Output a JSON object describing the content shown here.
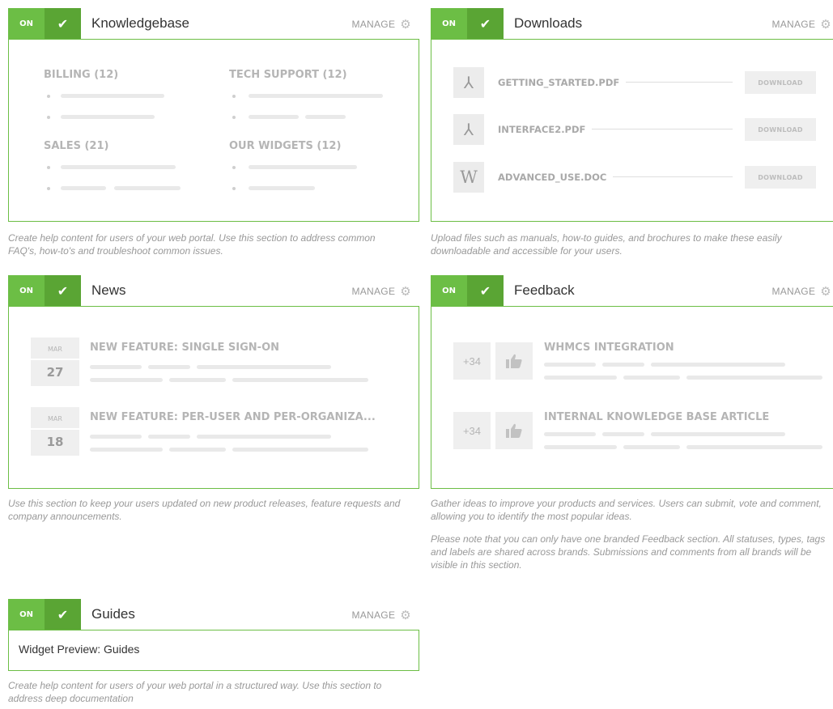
{
  "toggle": {
    "on_label": "ON",
    "check_icon": "check-icon"
  },
  "manage_label": "MANAGE",
  "colors": {
    "accent": "#6cbe45",
    "accent_dark": "#5aa534",
    "placeholder": "#b5b5b5"
  },
  "knowledgebase": {
    "title": "Knowledgebase",
    "categories": [
      {
        "label": "BILLING (12)"
      },
      {
        "label": "TECH SUPPORT (12)"
      },
      {
        "label": "SALES (21)"
      },
      {
        "label": "OUR WIDGETS (12)"
      }
    ],
    "description": "Create help content for users of your web portal. Use this section to address common FAQ's, how-to's and troubleshoot common issues."
  },
  "downloads": {
    "title": "Downloads",
    "files": [
      {
        "name": "GETTING_STARTED.PDF",
        "icon": "pdf-icon",
        "button": "DOWNLOAD"
      },
      {
        "name": "INTERFACE2.PDF",
        "icon": "pdf-icon",
        "button": "DOWNLOAD"
      },
      {
        "name": "ADVANCED_USE.DOC",
        "icon": "word-doc-icon",
        "icon_glyph": "W",
        "button": "DOWNLOAD"
      }
    ],
    "description": "Upload files such as manuals, how-to guides, and brochures to make these easily downloadable and accessible for your users."
  },
  "news": {
    "title": "News",
    "items": [
      {
        "month": "MAR",
        "day": "27",
        "title": "NEW FEATURE: SINGLE SIGN-ON"
      },
      {
        "month": "MAR",
        "day": "18",
        "title": "NEW FEATURE: PER-USER AND PER-ORGANIZA..."
      }
    ],
    "description": "Use this section to keep your users updated on new product releases, feature requests and company announcements."
  },
  "feedback": {
    "title": "Feedback",
    "items": [
      {
        "votes": "+34",
        "title": "WHMCS INTEGRATION"
      },
      {
        "votes": "+34",
        "title": "INTERNAL KNOWLEDGE BASE ARTICLE"
      }
    ],
    "description": "Gather ideas to improve your products and services. Users can submit, vote and comment, allowing you to identify the most popular ideas.",
    "note": "Please note that you can only have one branded Feedback section. All statuses, types, tags and labels are shared across brands. Submissions and comments from all brands will be visible in this section."
  },
  "guides": {
    "title": "Guides",
    "preview": "Widget Preview: Guides",
    "description": "Create help content for users of your web portal in a structured way. Use this section to address deep documentation"
  }
}
